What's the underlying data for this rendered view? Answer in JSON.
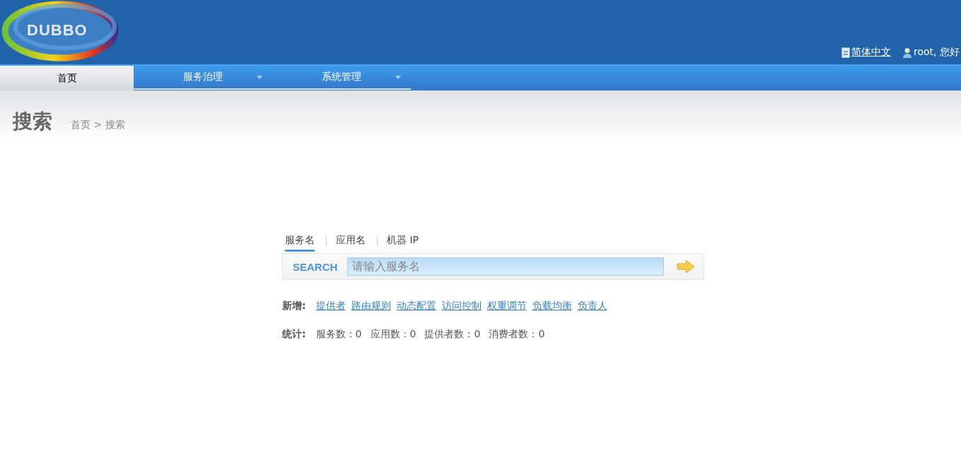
{
  "header": {
    "logo_text": "DUBBO",
    "language": "简体中文",
    "user": "root, 您好"
  },
  "nav": [
    {
      "label": "首页",
      "selected": true,
      "dropdown": false
    },
    {
      "label": "服务治理",
      "selected": false,
      "dropdown": true
    },
    {
      "label": "系统管理",
      "selected": false,
      "dropdown": true
    }
  ],
  "page": {
    "title": "搜索",
    "breadcrumb": "首页 > 搜索"
  },
  "search": {
    "tabs": [
      {
        "label": "服务名",
        "selected": true
      },
      {
        "label": "应用名",
        "selected": false
      },
      {
        "label": "机器 IP",
        "selected": false
      }
    ],
    "label": "SEARCH",
    "placeholder": "请输入服务名"
  },
  "add": {
    "label": "新增:",
    "links": [
      "提供者",
      "路由规则",
      "动态配置",
      "访问控制",
      "权重调节",
      "负载均衡",
      "负责人"
    ]
  },
  "stats": {
    "label": "统计:",
    "items": [
      "服务数：0",
      "应用数：0",
      "提供者数：0",
      "消费者数：0"
    ]
  }
}
